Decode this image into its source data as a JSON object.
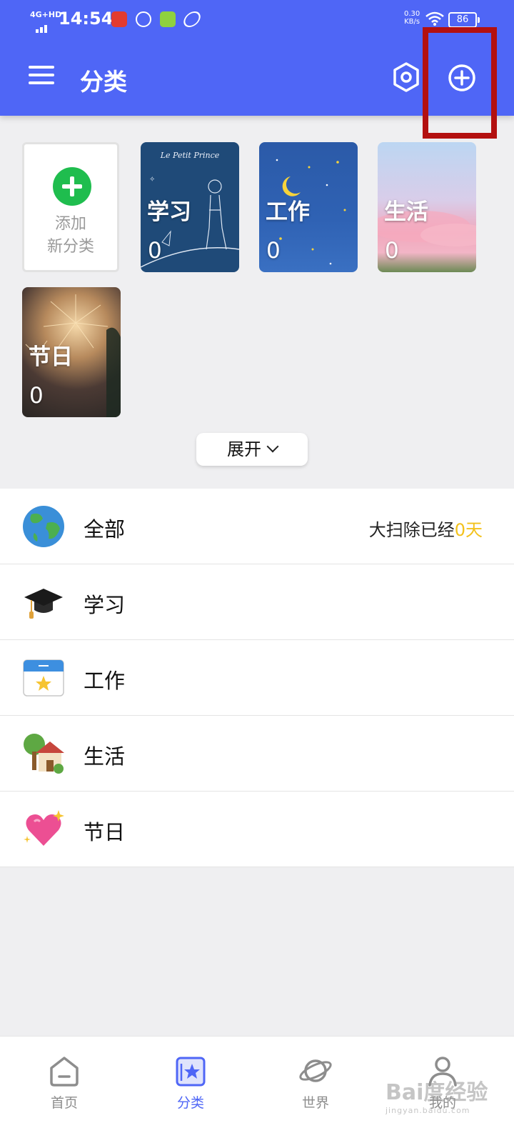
{
  "status_bar": {
    "network": "4G+HD",
    "time": "14:54",
    "speed": "0.30",
    "speed_unit": "KB/s",
    "battery": "86"
  },
  "header": {
    "title": "分类"
  },
  "add_card": {
    "line1": "添加",
    "line2": "新分类"
  },
  "cards": [
    {
      "name": "学习",
      "count": "0",
      "caption": "Le Petit Prince"
    },
    {
      "name": "工作",
      "count": "0"
    },
    {
      "name": "生活",
      "count": "0"
    },
    {
      "name": "节日",
      "count": "0"
    }
  ],
  "expand": {
    "label": "展开"
  },
  "list": [
    {
      "name": "全部",
      "icon": "globe-icon",
      "note_prefix": "大扫除已经",
      "note_days": "0天"
    },
    {
      "name": "学习",
      "icon": "graduation-cap-icon"
    },
    {
      "name": "工作",
      "icon": "calendar-star-icon"
    },
    {
      "name": "生活",
      "icon": "house-tree-icon"
    },
    {
      "name": "节日",
      "icon": "sparkling-heart-icon"
    }
  ],
  "tabs": [
    {
      "label": "首页",
      "icon": "home-icon"
    },
    {
      "label": "分类",
      "icon": "category-icon",
      "active": true
    },
    {
      "label": "世界",
      "icon": "planet-icon"
    },
    {
      "label": "我的",
      "icon": "profile-icon"
    }
  ],
  "watermark": {
    "text": "Bai度经验",
    "sub": "jingyan.baidu.com"
  },
  "colors": {
    "primary": "#4f66f6",
    "accent_yellow": "#f3c21c",
    "add_green": "#1fbd4e",
    "highlight_red": "#b31010"
  }
}
